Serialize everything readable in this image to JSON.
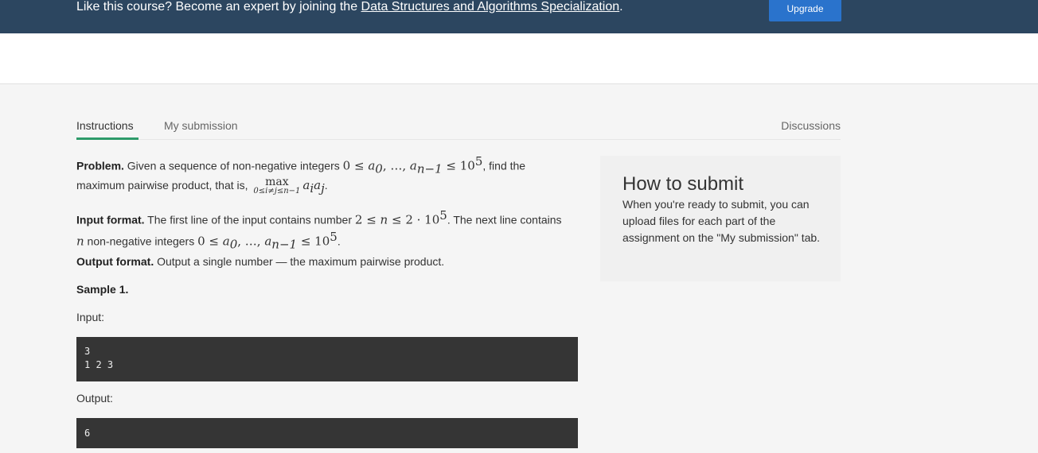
{
  "banner": {
    "text_before": "Like this course? Become an expert by joining the ",
    "link": "Data Structures and Algorithms Specialization",
    "text_after": ".",
    "upgrade_label": "Upgrade"
  },
  "tabs": {
    "instructions": "Instructions",
    "submission": "My submission",
    "discussions": "Discussions"
  },
  "problem": {
    "label": "Problem.",
    "text1": " Given a sequence of non-negative integers ",
    "text2": ", find the",
    "text3": "maximum pairwise product, that is, ",
    "max": "max",
    "max_limits": "0≤i≠j≤n−1",
    "text4": "."
  },
  "input_format": {
    "label": "Input format.",
    "text1": " The first line of the input contains number ",
    "text2": ". The next line contains",
    "text3": " non-negative integers ",
    "text4": "."
  },
  "output_format": {
    "label": "Output format.",
    "text": " Output a single number — the maximum pairwise product."
  },
  "sample": {
    "label": "Sample 1.",
    "input_label": "Input:",
    "input_lines": [
      "3",
      "1 2 3"
    ],
    "output_label": "Output:",
    "output_lines": [
      "6"
    ]
  },
  "how_to_submit": {
    "title": "How to submit",
    "text": "When you're ready to submit, you can upload files for each part of the assignment on the \"My submission\" tab."
  },
  "colors": {
    "banner_bg": "#2c4660",
    "upgrade_bg": "#2a73cc",
    "tab_active_underline": "#2e9b6a",
    "code_bg": "#353535"
  }
}
